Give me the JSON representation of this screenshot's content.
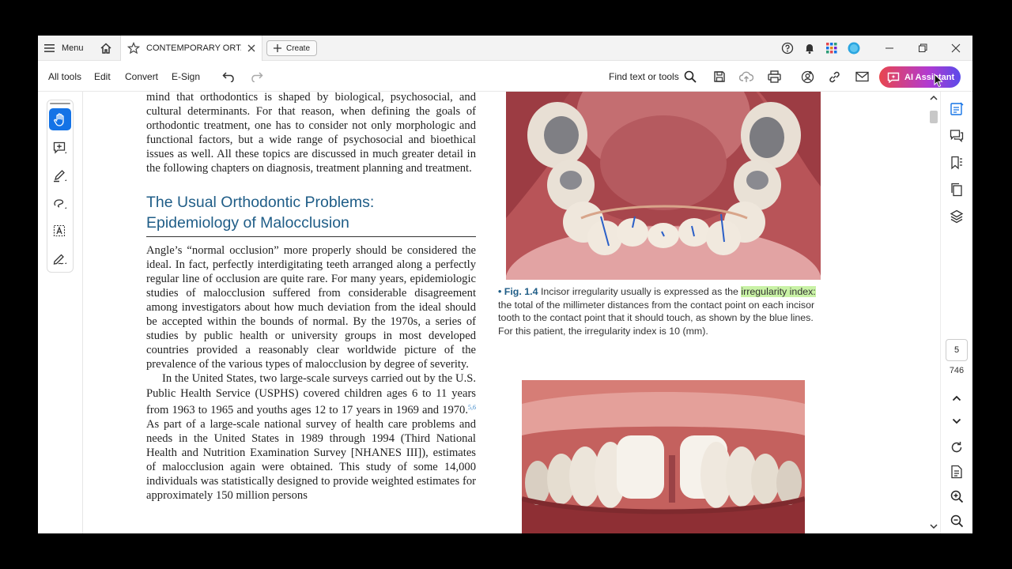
{
  "titlebar": {
    "menu_label": "Menu",
    "tab_title": "CONTEMPORARY ORT...",
    "create_label": "Create"
  },
  "toolbar": {
    "all_tools": "All tools",
    "edit": "Edit",
    "convert": "Convert",
    "esign": "E-Sign",
    "find_text": "Find text or tools",
    "ai_assistant": "AI Assistant"
  },
  "document": {
    "para1": "mind that orthodontics is shaped by biological, psychosocial, and cultural determinants. For that reason, when defining the goals of orthodontic treatment, one has to consider not only morphologic and functional factors, but a wide range of psychosocial and bioethical issues as well. All these topics are discussed in much greater detail in the following chapters on diagnosis, treatment planning and treatment.",
    "heading_line1": "The Usual Orthodontic Problems:",
    "heading_line2": "Epidemiology of Malocclusion",
    "para2": "Angle’s “normal occlusion” more properly should be considered the ideal. In fact, perfectly interdigitating teeth arranged along a perfectly regular line of occlusion are quite rare. For many years, epidemiologic studies of malocclusion suffered from considerable disagreement among investigators about how much deviation from the ideal should be accepted within the bounds of normal. By the 1970s, a series of studies by public health or university groups in most developed countries provided a reasonably clear worldwide picture of the prevalence of the various types of malocclusion by degree of severity.",
    "para3_a": "In the United States, two large-scale surveys carried out by the U.S. Public Health Service (USPHS) covered children ages 6 to 11 years from 1963 to 1965 and youths ages 12 to 17 years in 1969 and 1970.",
    "para3_ref": "5,6",
    "para3_b": " As part of a large-scale national survey of health care problems and needs in the United States in 1989 through 1994 (Third National Health and Nutrition Examination Survey [NHANES III]), estimates of malocclusion again were obtained. This study of some 14,000 individuals was statistically designed to provide weighted estimates for approximately 150 million persons"
  },
  "caption": {
    "bullet": "•",
    "label": "Fig. 1.4",
    "text_before": "Incisor irregularity usually is expressed as the ",
    "highlight": "irregularity index:",
    "text_after": " the total of the millimeter distances from the contact point on each incisor tooth to the contact point that it should touch, as shown by the blue lines. For this patient, the irregularity index is 10 (mm)."
  },
  "navigation": {
    "current_page": "5",
    "total_pages": "746"
  },
  "colors": {
    "heading": "#1f5d87",
    "highlight": "#c9f2a6",
    "active_tool": "#1473e6"
  }
}
